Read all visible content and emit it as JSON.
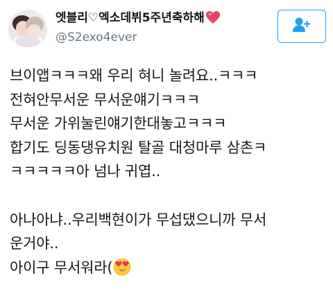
{
  "user": {
    "display_name": "엣블리♡엑소데뷔5주년축하해",
    "handle": "@S2exo4ever",
    "avatar_icon": "profile-photo",
    "name_emoji": "red-heart-icon"
  },
  "follow_button": {
    "icon": "add-user-icon",
    "accent_color": "#1da1f2"
  },
  "tweet": {
    "lines": [
      "브이앱ㅋㅋㅋ왜 우리 혀니 놀려요..ㅋㅋㅋ",
      "전혀안무서운 무서운얘기ㅋㅋㅋ",
      "무서운 가위눌린얘기한대놓고ㅋㅋㅋ",
      "합기도 딩동댕유치원 탈골 대청마루 삼촌ㅋ",
      "ㅋㅋㅋㅋㅋ아 넘나 귀엽..",
      "",
      "아나아냐..우리백현이가 무섭댔으니까 무서",
      "운거야..",
      "아이구 무서워라("
    ],
    "trailing_emoji": "heart-eyes-emoji-icon"
  }
}
